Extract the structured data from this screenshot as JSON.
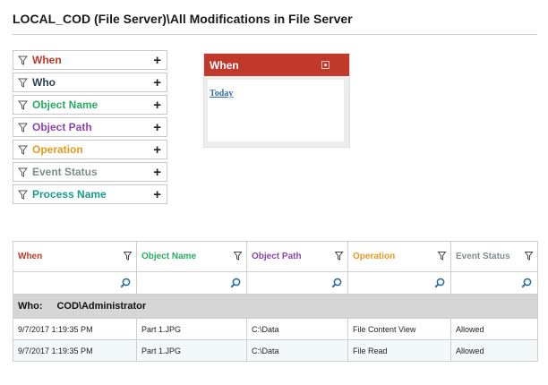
{
  "page": {
    "title": "LOCAL_COD (File Server)\\All Modifications in File Server"
  },
  "filters": [
    {
      "label": "When",
      "color": "#c0392b"
    },
    {
      "label": "Who",
      "color": "#2c3e50"
    },
    {
      "label": "Object Name",
      "color": "#27ae60"
    },
    {
      "label": "Object Path",
      "color": "#8e44ad"
    },
    {
      "label": "Operation",
      "color": "#e69a1c"
    },
    {
      "label": "Event Status",
      "color": "#7f8c8d"
    },
    {
      "label": "Process Name",
      "color": "#16a085"
    }
  ],
  "filter_icons": {
    "funnel": "funnel-icon",
    "add": "plus-icon"
  },
  "when_panel": {
    "title": "When",
    "link": "Today",
    "header_color": "#c0392b"
  },
  "grid": {
    "columns": [
      {
        "label": "When",
        "color": "#c0392b"
      },
      {
        "label": "Object Name",
        "color": "#27ae60"
      },
      {
        "label": "Object Path",
        "color": "#8e44ad"
      },
      {
        "label": "Operation",
        "color": "#e69a1c"
      },
      {
        "label": "Event Status",
        "color": "#7f8c8d"
      }
    ],
    "group": {
      "label": "Who:",
      "value": "COD\\Administrator"
    },
    "rows": [
      [
        "9/7/2017 1:19:35 PM",
        "Part 1.JPG",
        "C:\\Data",
        "File Content View",
        "Allowed"
      ],
      [
        "9/7/2017 1:19:35 PM",
        "Part 1.JPG",
        "C:\\Data",
        "File Read",
        "Allowed"
      ]
    ]
  }
}
